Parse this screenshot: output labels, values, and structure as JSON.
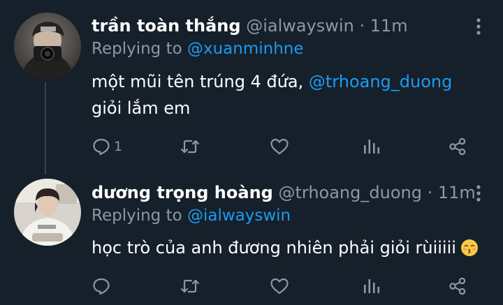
{
  "colors": {
    "background": "#15202b",
    "text": "#ffffff",
    "secondary": "#8b98a5",
    "accent": "#1d9bf0",
    "thread_line": "#38444d"
  },
  "tweets": [
    {
      "display_name": "trần toàn thắng",
      "handle": "@ialwayswin",
      "time": "· 11m",
      "replying_prefix": "Replying to ",
      "replying_to": "@xuanminhne",
      "text_before": "một mũi tên trúng 4 đứa, ",
      "mention": "@trhoang_duong",
      "text_after": " giỏi lắm em",
      "reply_count": "1",
      "icons": [
        "reply-icon",
        "retweet-icon",
        "like-icon",
        "views-icon",
        "share-icon",
        "more-icon"
      ]
    },
    {
      "display_name": "dương trọng hoàng",
      "handle": "@trhoang_duong",
      "time": "· 11m",
      "replying_prefix": "Replying to ",
      "replying_to": "@ialwayswin",
      "text": "học trò của anh đương nhiên phải giỏi rùiiiii",
      "emoji": "kissing-face-with-closed-eyes",
      "reply_count": "",
      "icons": [
        "reply-icon",
        "retweet-icon",
        "like-icon",
        "views-icon",
        "share-icon",
        "more-icon"
      ]
    }
  ]
}
